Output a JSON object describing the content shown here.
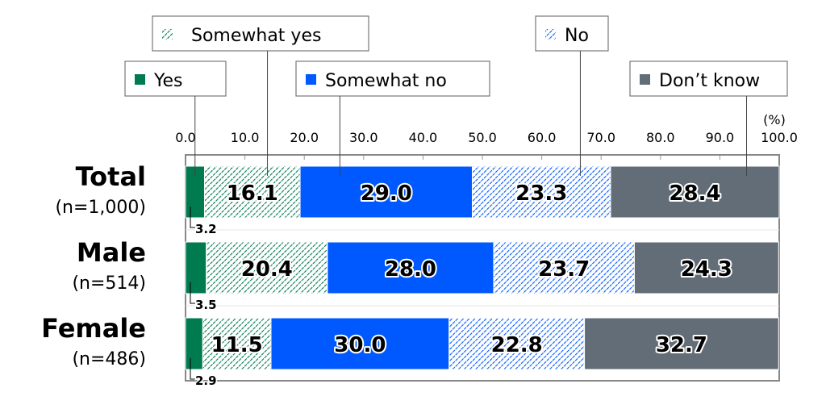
{
  "chart_data": {
    "type": "bar",
    "orientation": "horizontal",
    "stacked": true,
    "title": "",
    "xlabel": "",
    "ylabel": "",
    "unit_label": "(%)",
    "xlim": [
      0,
      100
    ],
    "x_ticks": [
      "0.0",
      "10.0",
      "20.0",
      "30.0",
      "40.0",
      "50.0",
      "60.0",
      "70.0",
      "80.0",
      "90.0",
      "100.0"
    ],
    "legend_placement": "top",
    "categories": [
      {
        "name": "Total",
        "n": "(n=1,000)"
      },
      {
        "name": "Male",
        "n": "(n=514)"
      },
      {
        "name": "Female",
        "n": "(n=486)"
      }
    ],
    "series": [
      {
        "name": "Yes",
        "color": "#007a4f",
        "pattern": "solid",
        "values": [
          3.2,
          3.5,
          2.9
        ],
        "labels": [
          "3.2",
          "3.5",
          "2.9"
        ]
      },
      {
        "name": "Somewhat yes",
        "color": "#007a4f",
        "pattern": "hatch",
        "values": [
          16.1,
          20.4,
          11.5
        ],
        "labels": [
          "16.1",
          "20.4",
          "11.5"
        ]
      },
      {
        "name": "Somewhat no",
        "color": "#0058ff",
        "pattern": "solid",
        "values": [
          29.0,
          28.0,
          30.0
        ],
        "labels": [
          "29.0",
          "28.0",
          "30.0"
        ]
      },
      {
        "name": "No",
        "color": "#0058ff",
        "pattern": "hatch",
        "values": [
          23.3,
          23.7,
          22.8
        ],
        "labels": [
          "23.3",
          "23.7",
          "22.8"
        ]
      },
      {
        "name": "Don’t know",
        "color": "#636d77",
        "pattern": "solid",
        "values": [
          28.4,
          24.3,
          32.7
        ],
        "labels": [
          "28.4",
          "24.3",
          "32.7"
        ]
      }
    ]
  }
}
